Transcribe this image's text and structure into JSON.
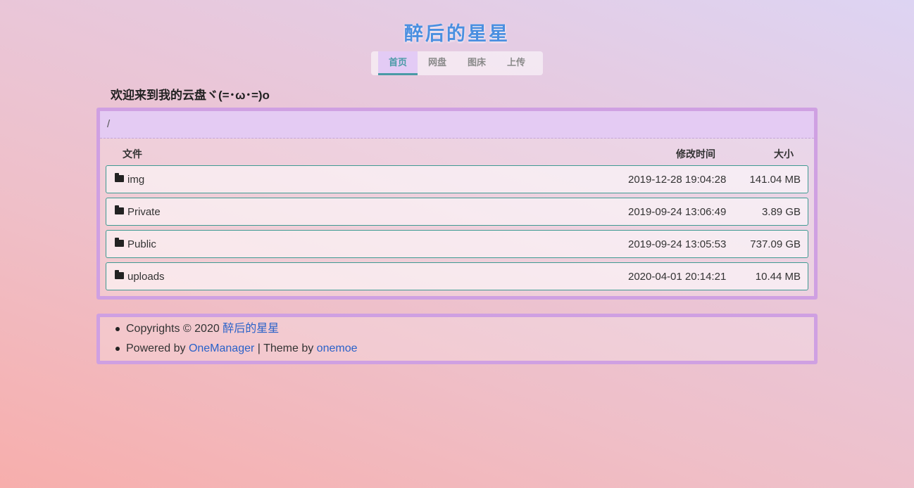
{
  "site": {
    "title": "醉后的星星"
  },
  "nav": {
    "items": [
      {
        "label": "首页",
        "active": true
      },
      {
        "label": "网盘",
        "active": false
      },
      {
        "label": "图床",
        "active": false
      },
      {
        "label": "上传",
        "active": false
      }
    ]
  },
  "welcome": "欢迎来到我的云盘ヾ(=･ω･=)o",
  "breadcrumb": "/",
  "table": {
    "headers": {
      "name": "文件",
      "modified": "修改时间",
      "size": "大小"
    },
    "rows": [
      {
        "name": "img",
        "modified": "2019-12-28 19:04:28",
        "size": "141.04 MB",
        "icon": "folder-icon"
      },
      {
        "name": "Private",
        "modified": "2019-09-24 13:06:49",
        "size": "3.89 GB",
        "icon": "folder-icon"
      },
      {
        "name": "Public",
        "modified": "2019-09-24 13:05:53",
        "size": "737.09 GB",
        "icon": "folder-icon"
      },
      {
        "name": "uploads",
        "modified": "2020-04-01 20:14:21",
        "size": "10.44 MB",
        "icon": "folder-icon"
      }
    ]
  },
  "footer": {
    "copyright_prefix": "Copyrights © 2020 ",
    "copyright_link": "醉后的星星",
    "powered_prefix": "Powered by ",
    "powered_link": "OneManager",
    "theme_prefix": " | Theme by ",
    "theme_link": "onemoe"
  },
  "colors": {
    "title": "#4a8fe0",
    "panel_border": "#cfa0e2",
    "row_border": "#3f9a92",
    "link": "#2a62c9",
    "nav_active_bg": "#e3cbf5",
    "nav_active_text": "#4a9aa6"
  }
}
